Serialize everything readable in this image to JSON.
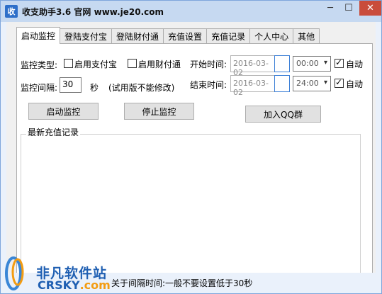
{
  "window": {
    "icon_text": "收",
    "title": "收支助手3.6 官网 www.je20.com",
    "minimize_glyph": "─",
    "maximize_glyph": "☐",
    "close_glyph": "✕"
  },
  "tabs": [
    {
      "label": "启动监控",
      "active": true
    },
    {
      "label": "登陆支付宝",
      "active": false
    },
    {
      "label": "登陆财付通",
      "active": false
    },
    {
      "label": "充值设置",
      "active": false
    },
    {
      "label": "充值记录",
      "active": false
    },
    {
      "label": "个人中心",
      "active": false
    },
    {
      "label": "其他",
      "active": false
    }
  ],
  "monitor": {
    "type_label": "监控类型:",
    "alipay_label": "启用支付宝",
    "alipay_checked": false,
    "tenpay_label": "启用财付通",
    "tenpay_checked": false,
    "interval_label": "监控间隔:",
    "interval_value": "30",
    "seconds_label": "秒",
    "trial_note": "(试用版不能修改)"
  },
  "schedule": {
    "start_label": "开始时间:",
    "start_date": "2016-03-02",
    "start_time": "00:00",
    "start_auto_label": "自动",
    "start_auto_checked": true,
    "end_label": "结束时间:",
    "end_date": "2016-03-02",
    "end_time": "24:00",
    "end_auto_label": "自动",
    "end_auto_checked": true
  },
  "buttons": {
    "start": "启动监控",
    "stop": "停止监控",
    "join_qq": "加入QQ群"
  },
  "log": {
    "title": "最新充值记录"
  },
  "footer": {
    "hint": "关于间隔时间:一般不要设置低于30秒",
    "watermark_cn": "非凡软件站",
    "watermark_en_a": "CRSKY",
    "watermark_en_b": ".com"
  }
}
